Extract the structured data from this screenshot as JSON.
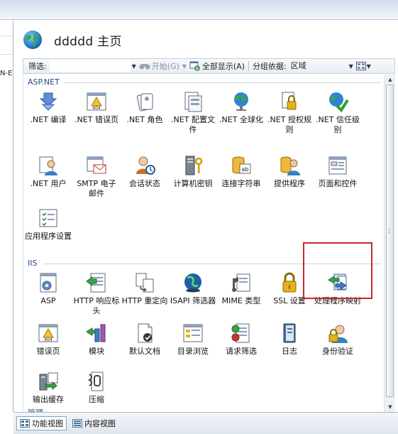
{
  "left_pane": {
    "fragment": "N-E"
  },
  "header": {
    "title": "ddddd 主页",
    "icon": "globe-icon"
  },
  "toolbar": {
    "filter_label": "筛选:",
    "start_label": "开始(G)",
    "show_all_label": "全部显示(A)",
    "group_by_label": "分组依据:",
    "group_by_value": "区域"
  },
  "groups": [
    {
      "name": "ASP.NET",
      "items": [
        {
          "label": ".NET 编译",
          "icon": "down-arrows-icon"
        },
        {
          "label": ".NET 错误页",
          "icon": "error-404-icon"
        },
        {
          "label": ".NET 角色",
          "icon": "roles-icon"
        },
        {
          "label": ".NET 配置文件",
          "icon": "profile-icon"
        },
        {
          "label": ".NET 全球化",
          "icon": "globe-icon"
        },
        {
          "label": ".NET 授权规则",
          "icon": "lock-icon"
        },
        {
          "label": ".NET 信任级别",
          "icon": "trust-check-icon"
        },
        {
          "label": ".NET 用户",
          "icon": "user-icon"
        },
        {
          "label": "SMTP 电子邮件",
          "icon": "email-icon"
        },
        {
          "label": "会话状态",
          "icon": "session-icon"
        },
        {
          "label": "计算机密钥",
          "icon": "machine-key-icon"
        },
        {
          "label": "连接字符串",
          "icon": "connection-string-icon"
        },
        {
          "label": "提供程序",
          "icon": "providers-icon"
        },
        {
          "label": "页面和控件",
          "icon": "pages-controls-icon"
        },
        {
          "label": "应用程序设置",
          "icon": "app-settings-icon"
        }
      ]
    },
    {
      "name": "IIS",
      "items": [
        {
          "label": "ASP",
          "icon": "asp-icon"
        },
        {
          "label": "HTTP 响应标头",
          "icon": "http-headers-icon"
        },
        {
          "label": "HTTP 重定向",
          "icon": "redirect-icon"
        },
        {
          "label": "ISAPI 筛选器",
          "icon": "isapi-icon"
        },
        {
          "label": "MIME 类型",
          "icon": "mime-icon"
        },
        {
          "label": "SSL 设置",
          "icon": "padlock-icon"
        },
        {
          "label": "处理程序映射",
          "icon": "handler-mappings-icon"
        },
        {
          "label": "错误页",
          "icon": "error-404-icon"
        },
        {
          "label": "模块",
          "icon": "modules-icon"
        },
        {
          "label": "默认文档",
          "icon": "default-document-icon"
        },
        {
          "label": "目录浏览",
          "icon": "directory-browsing-icon"
        },
        {
          "label": "请求筛选",
          "icon": "request-filtering-icon"
        },
        {
          "label": "日志",
          "icon": "logging-icon"
        },
        {
          "label": "身份验证",
          "icon": "authentication-icon"
        },
        {
          "label": "输出缓存",
          "icon": "output-cache-icon"
        },
        {
          "label": "压缩",
          "icon": "compression-icon"
        }
      ]
    },
    {
      "name": "管理"
    }
  ],
  "bottom": {
    "features_view": "功能视图",
    "content_view": "内容视图"
  },
  "colors": {
    "highlight": "#c8272b",
    "group_header": "#1f4a8a"
  }
}
